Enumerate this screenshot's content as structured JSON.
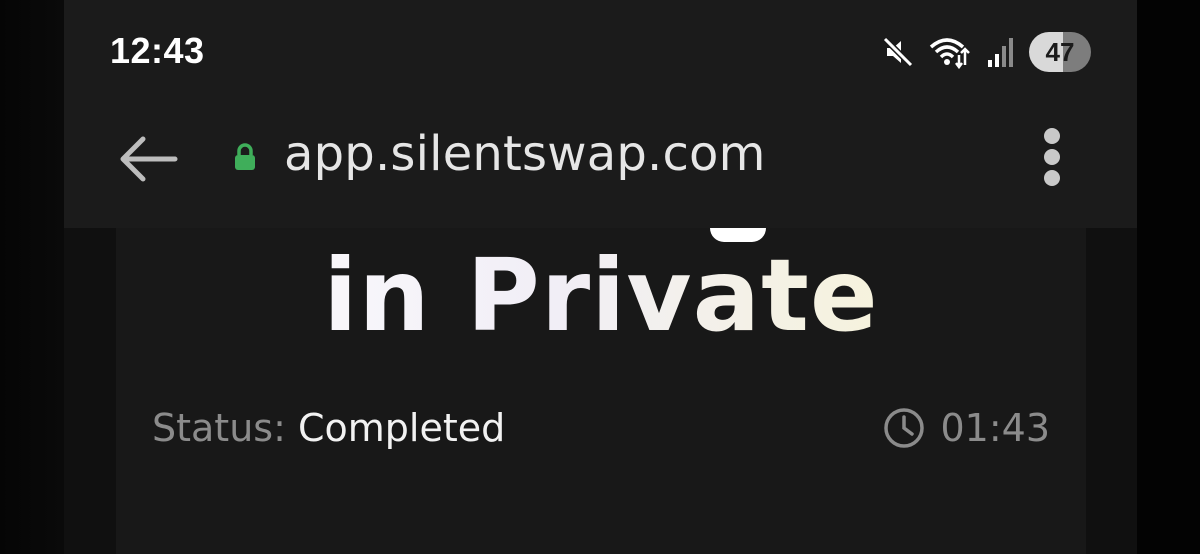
{
  "status_bar": {
    "time": "12:43",
    "battery_level": "47",
    "icons": [
      "mute-icon",
      "wifi-icon",
      "signal-icon",
      "battery-icon"
    ]
  },
  "browser": {
    "url": "app.silentswap.com",
    "icons": [
      "back-arrow-icon",
      "lock-icon",
      "more-vert-icon"
    ]
  },
  "page": {
    "headline": "in Private",
    "status_label": "Status:",
    "status_value": "Completed",
    "timer": "01:43"
  },
  "colors": {
    "background": "#141414",
    "lock_green": "#3fae5a",
    "muted_text": "#8b8b8b"
  }
}
